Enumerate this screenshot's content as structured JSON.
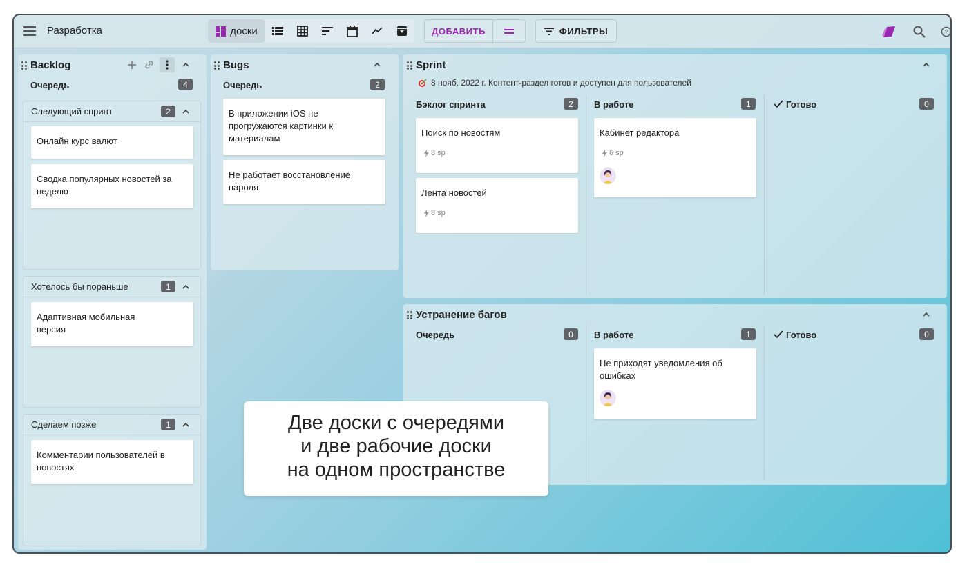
{
  "header": {
    "workspace_title": "Разработка",
    "views": [
      {
        "name": "boards",
        "label": "доски",
        "icon": "boards-icon",
        "active": true
      },
      {
        "name": "list",
        "icon": "list-icon"
      },
      {
        "name": "table",
        "icon": "table-icon"
      },
      {
        "name": "sort",
        "icon": "sort-icon"
      },
      {
        "name": "calendar",
        "icon": "calendar-icon"
      },
      {
        "name": "chart",
        "icon": "chart-icon"
      },
      {
        "name": "archive",
        "icon": "archive-icon"
      }
    ],
    "add_label": "ДОБАВИТЬ",
    "filters_label": "ФИЛЬТРЫ",
    "accent_color": "#9c27b0"
  },
  "backlog": {
    "title": "Backlog",
    "queue_label": "Очередь",
    "queue_count": "4",
    "groups": [
      {
        "title": "Следующий спринт",
        "count": "2",
        "cards": [
          "Онлайн курс валют",
          "Сводка популярных новостей за неделю"
        ]
      },
      {
        "title": "Хотелось бы пораньше",
        "count": "1",
        "cards": [
          "Адаптивная мобильная версия"
        ]
      },
      {
        "title": "Сделаем позже",
        "count": "1",
        "cards": [
          "Комментарии пользователей в новостях"
        ]
      }
    ]
  },
  "bugs": {
    "title": "Bugs",
    "queue_label": "Очередь",
    "queue_count": "2",
    "cards": [
      "В приложении iOS не прогружаются картинки к материалам",
      "Не работает восстановление пароля"
    ]
  },
  "sprint": {
    "title": "Sprint",
    "goal": "8 нояб. 2022 г. Контент-раздел готов и доступен для пользователей",
    "columns": [
      {
        "title": "Бэклог спринта",
        "count": "2",
        "cards": [
          {
            "title": "Поиск по новостям",
            "sp": "8 sp"
          },
          {
            "title": "Лента новостей",
            "sp": "8 sp"
          }
        ]
      },
      {
        "title": "В работе",
        "count": "1",
        "cards": [
          {
            "title": "Кабинет редактора",
            "sp": "6 sp"
          }
        ]
      },
      {
        "title": "Готово",
        "count": "0",
        "cards": []
      }
    ]
  },
  "bugfix": {
    "title": "Устранение багов",
    "columns": [
      {
        "title": "Очередь",
        "count": "0",
        "cards": []
      },
      {
        "title": "В работе",
        "count": "1",
        "cards": [
          {
            "title": "Не приходят уведомления об ошибках"
          }
        ]
      },
      {
        "title": "Готово",
        "count": "0",
        "cards": []
      }
    ]
  },
  "caption": {
    "line1": "Две доски с очередями",
    "line2": "и две рабочие доски",
    "line3": "на одном пространстве"
  }
}
